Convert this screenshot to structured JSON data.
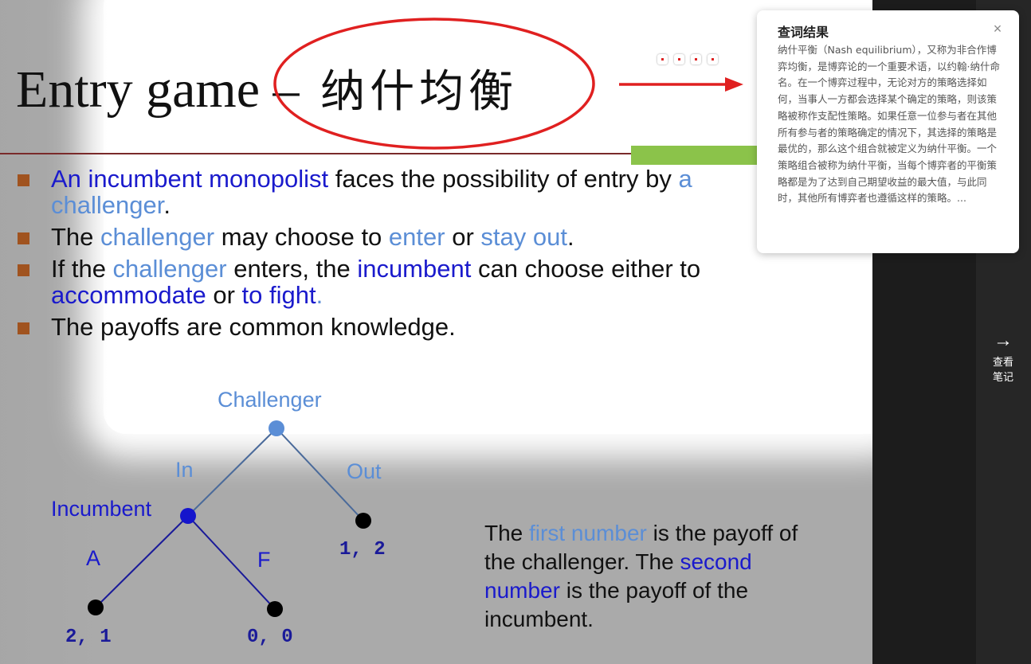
{
  "slide": {
    "title_en": "Entry game – ",
    "title_cn": "纳什均衡",
    "bullets": [
      {
        "parts": [
          {
            "t": "An incumbent monopolist",
            "c": "db"
          },
          {
            "t": " faces the possibility of entry by ",
            "c": ""
          },
          {
            "t": "a challenger",
            "c": "lb"
          },
          {
            "t": ".",
            "c": ""
          }
        ]
      },
      {
        "parts": [
          {
            "t": "The ",
            "c": ""
          },
          {
            "t": "challenger",
            "c": "lb"
          },
          {
            "t": " may choose to ",
            "c": ""
          },
          {
            "t": "enter",
            "c": "lb"
          },
          {
            "t": " or ",
            "c": ""
          },
          {
            "t": "stay out",
            "c": "lb"
          },
          {
            "t": ".",
            "c": ""
          }
        ]
      },
      {
        "parts": [
          {
            "t": "If the ",
            "c": ""
          },
          {
            "t": "challenger",
            "c": "lb"
          },
          {
            "t": " enters, the ",
            "c": ""
          },
          {
            "t": "incumbent",
            "c": "db"
          },
          {
            "t": " can choose either to ",
            "c": ""
          },
          {
            "t": "accommodate",
            "c": "db"
          },
          {
            "t": "  or ",
            "c": ""
          },
          {
            "t": "to fight",
            "c": "db"
          },
          {
            "t": ".",
            "c": "lb"
          }
        ]
      },
      {
        "parts": [
          {
            "t": "The payoffs are common knowledge.",
            "c": ""
          }
        ]
      }
    ],
    "tree": {
      "root_label": "Challenger",
      "in_label": "In",
      "out_label": "Out",
      "incumbent_label": "Incumbent",
      "a_label": "A",
      "f_label": "F",
      "payoff_out": "1, 2",
      "payoff_a": "2, 1",
      "payoff_f": "0, 0"
    },
    "explain": [
      {
        "t": "The ",
        "c": ""
      },
      {
        "t": "first number",
        "c": "lb"
      },
      {
        "t": " is the payoff of the challenger. The ",
        "c": ""
      },
      {
        "t": "second number",
        "c": "db"
      },
      {
        "t": " is the payoff of the incumbent.",
        "c": ""
      }
    ]
  },
  "popup": {
    "title": "查词结果",
    "close_icon": "close-icon",
    "body": "纳什平衡（Nash equilibrium），又称为非合作博弈均衡，是博弈论的一个重要术语，以约翰·纳什命名。在一个博弈过程中，无论对方的策略选择如何，当事人一方都会选择某个确定的策略，则该策略被称作支配性策略。如果任意一位参与者在其他所有参与者的策略确定的情况下，其选择的策略是最优的，那么这个组合就被定义为纳什平衡。一个策略组合被称为纳什平衡，当每个博弈者的平衡策略都是为了达到自己期望收益的最大值，与此同时，其他所有博弈者也遵循这样的策略。..."
  },
  "sidebar": {
    "notes_icon": "arrow-right-icon",
    "notes_label": "查看笔记",
    "notes_line1": "查看",
    "notes_line2": "笔记"
  }
}
